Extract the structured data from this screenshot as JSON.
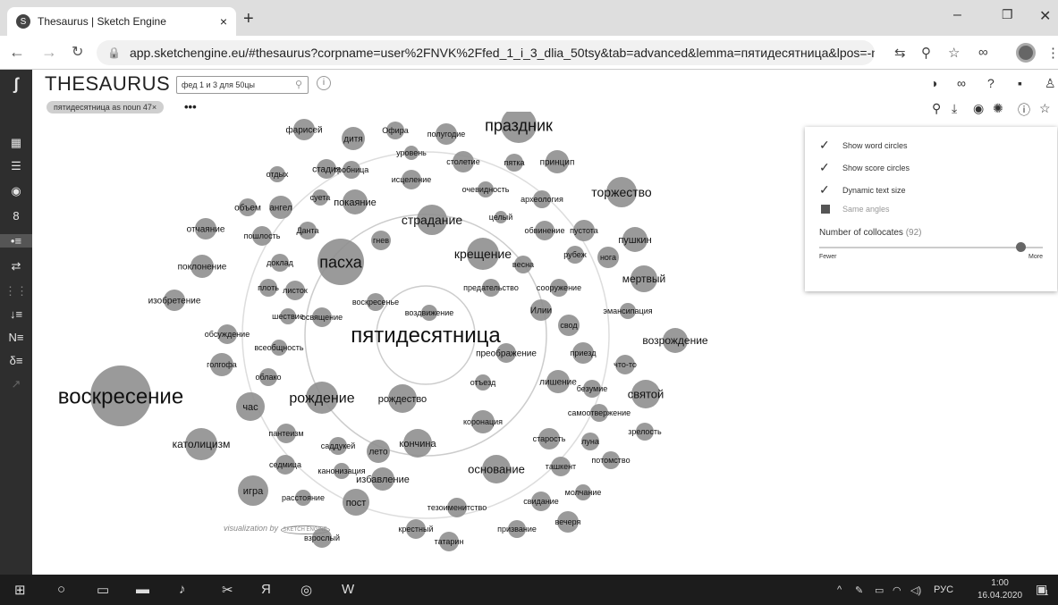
{
  "browser": {
    "tab_title": "Thesaurus | Sketch Engine",
    "tab_close": "×",
    "new_tab": "+",
    "url": "app.sketchengine.eu/#thesaurus?corpname=user%2FNVK%2Ffed_1_i_3_dlia_50tsy&tab=advanced&lemma=пятидесятница&lpos=-n&showThes...",
    "window_minimize": "–",
    "window_restore": "❐",
    "window_close": "✕"
  },
  "app": {
    "title": "THESAURUS",
    "corpus_name": "фед 1 и 3 для 50цы",
    "query_chip": "пятидесятница as noun 47×",
    "more_label": "•••",
    "info_label": "i"
  },
  "settings": {
    "show_word_circles": "Show word circles",
    "show_score_circles": "Show score circles",
    "dynamic_text_size": "Dynamic text size",
    "same_angles": "Same angles",
    "collocates_label": "Number of collocates",
    "collocates_count": "(92)",
    "collocates_level": 0.9,
    "fewer": "Fewer",
    "more": "More"
  },
  "visualization": {
    "center_word": "пятидесятница",
    "credit": "visualization by",
    "credit_logo": "SKETCH ENGINE",
    "words": [
      {
        "w": "воскресение",
        "fs": 24,
        "r": 34
      },
      {
        "w": "праздник",
        "fs": 18,
        "r": 20
      },
      {
        "w": "пасха",
        "fs": 18,
        "r": 26
      },
      {
        "w": "рождение",
        "fs": 16,
        "r": 18
      },
      {
        "w": "торжество",
        "fs": 14,
        "r": 17
      },
      {
        "w": "страдание",
        "fs": 14,
        "r": 17
      },
      {
        "w": "крещение",
        "fs": 14,
        "r": 18
      },
      {
        "w": "основание",
        "fs": 13,
        "r": 16
      },
      {
        "w": "святой",
        "fs": 13,
        "r": 16
      },
      {
        "w": "возрождение",
        "fs": 12,
        "r": 14
      },
      {
        "w": "мертвый",
        "fs": 12,
        "r": 15
      },
      {
        "w": "католицизм",
        "fs": 12,
        "r": 18
      },
      {
        "w": "пушкин",
        "fs": 11,
        "r": 14
      },
      {
        "w": "кончина",
        "fs": 11,
        "r": 16
      },
      {
        "w": "рождество",
        "fs": 11,
        "r": 16
      },
      {
        "w": "игра",
        "fs": 11,
        "r": 17
      },
      {
        "w": "пост",
        "fs": 11,
        "r": 15
      },
      {
        "w": "покаяние",
        "fs": 11,
        "r": 14
      },
      {
        "w": "избавление",
        "fs": 11,
        "r": 13
      },
      {
        "w": "час",
        "fs": 11,
        "r": 16
      },
      {
        "w": "поклонение",
        "fs": 10,
        "r": 13
      },
      {
        "w": "изобретение",
        "fs": 10,
        "r": 12
      },
      {
        "w": "отчаяние",
        "fs": 10,
        "r": 12
      },
      {
        "w": "дитя",
        "fs": 10,
        "r": 13
      },
      {
        "w": "фарисей",
        "fs": 10,
        "r": 12
      },
      {
        "w": "Офира",
        "fs": 9,
        "r": 10
      },
      {
        "w": "полугодие",
        "fs": 9,
        "r": 12
      },
      {
        "w": "уровень",
        "fs": 9,
        "r": 8
      },
      {
        "w": "стадия",
        "fs": 10,
        "r": 11
      },
      {
        "w": "гробница",
        "fs": 9,
        "r": 10
      },
      {
        "w": "отдых",
        "fs": 9,
        "r": 9
      },
      {
        "w": "исцеление",
        "fs": 9,
        "r": 11
      },
      {
        "w": "столетие",
        "fs": 9,
        "r": 12
      },
      {
        "w": "пятка",
        "fs": 9,
        "r": 10
      },
      {
        "w": "принцип",
        "fs": 10,
        "r": 13
      },
      {
        "w": "объем",
        "fs": 10,
        "r": 10
      },
      {
        "w": "ангел",
        "fs": 10,
        "r": 13
      },
      {
        "w": "суета",
        "fs": 9,
        "r": 9
      },
      {
        "w": "очевидность",
        "fs": 9,
        "r": 9
      },
      {
        "w": "археология",
        "fs": 9,
        "r": 10
      },
      {
        "w": "пошлость",
        "fs": 9,
        "r": 11
      },
      {
        "w": "Данта",
        "fs": 9,
        "r": 10
      },
      {
        "w": "гнев",
        "fs": 9,
        "r": 11
      },
      {
        "w": "целый",
        "fs": 9,
        "r": 7
      },
      {
        "w": "обвинение",
        "fs": 9,
        "r": 11
      },
      {
        "w": "пустота",
        "fs": 9,
        "r": 12
      },
      {
        "w": "доклад",
        "fs": 9,
        "r": 10
      },
      {
        "w": "весна",
        "fs": 9,
        "r": 10
      },
      {
        "w": "рубеж",
        "fs": 9,
        "r": 10
      },
      {
        "w": "нога",
        "fs": 9,
        "r": 12
      },
      {
        "w": "плоть",
        "fs": 9,
        "r": 10
      },
      {
        "w": "листок",
        "fs": 9,
        "r": 11
      },
      {
        "w": "предательство",
        "fs": 9,
        "r": 10
      },
      {
        "w": "сооружение",
        "fs": 9,
        "r": 10
      },
      {
        "w": "воскресенье",
        "fs": 9,
        "r": 10
      },
      {
        "w": "шествие",
        "fs": 9,
        "r": 9
      },
      {
        "w": "освящение",
        "fs": 9,
        "r": 11
      },
      {
        "w": "воздвижение",
        "fs": 9,
        "r": 9
      },
      {
        "w": "Илии",
        "fs": 10,
        "r": 12
      },
      {
        "w": "эмансипация",
        "fs": 9,
        "r": 9
      },
      {
        "w": "обсуждение",
        "fs": 9,
        "r": 11
      },
      {
        "w": "свод",
        "fs": 9,
        "r": 12
      },
      {
        "w": "всеобщность",
        "fs": 9,
        "r": 9
      },
      {
        "w": "преображение",
        "fs": 10,
        "r": 11
      },
      {
        "w": "приезд",
        "fs": 9,
        "r": 12
      },
      {
        "w": "голгофа",
        "fs": 9,
        "r": 13
      },
      {
        "w": "что-то",
        "fs": 9,
        "r": 11
      },
      {
        "w": "облако",
        "fs": 9,
        "r": 10
      },
      {
        "w": "отъезд",
        "fs": 9,
        "r": 9
      },
      {
        "w": "лишение",
        "fs": 10,
        "r": 13
      },
      {
        "w": "безумие",
        "fs": 9,
        "r": 10
      },
      {
        "w": "самоотвержение",
        "fs": 9,
        "r": 10
      },
      {
        "w": "пантеизм",
        "fs": 9,
        "r": 11
      },
      {
        "w": "коронация",
        "fs": 9,
        "r": 13
      },
      {
        "w": "зрелость",
        "fs": 9,
        "r": 10
      },
      {
        "w": "саддукей",
        "fs": 9,
        "r": 10
      },
      {
        "w": "лето",
        "fs": 10,
        "r": 13
      },
      {
        "w": "старость",
        "fs": 9,
        "r": 12
      },
      {
        "w": "луна",
        "fs": 9,
        "r": 10
      },
      {
        "w": "седмица",
        "fs": 9,
        "r": 11
      },
      {
        "w": "канонизация",
        "fs": 9,
        "r": 9
      },
      {
        "w": "ташкент",
        "fs": 9,
        "r": 11
      },
      {
        "w": "потомство",
        "fs": 9,
        "r": 10
      },
      {
        "w": "молчание",
        "fs": 9,
        "r": 9
      },
      {
        "w": "расстояние",
        "fs": 9,
        "r": 9
      },
      {
        "w": "свидание",
        "fs": 9,
        "r": 11
      },
      {
        "w": "тезоименитство",
        "fs": 9,
        "r": 11
      },
      {
        "w": "вечеря",
        "fs": 9,
        "r": 12
      },
      {
        "w": "крестный",
        "fs": 9,
        "r": 11
      },
      {
        "w": "призвание",
        "fs": 9,
        "r": 10
      },
      {
        "w": "взрослый",
        "fs": 9,
        "r": 11
      },
      {
        "w": "татарин",
        "fs": 9,
        "r": 11
      }
    ]
  },
  "taskbar": {
    "lang": "РУС",
    "time": "1:00",
    "date": "16.04.2020",
    "notif_count": "1"
  }
}
